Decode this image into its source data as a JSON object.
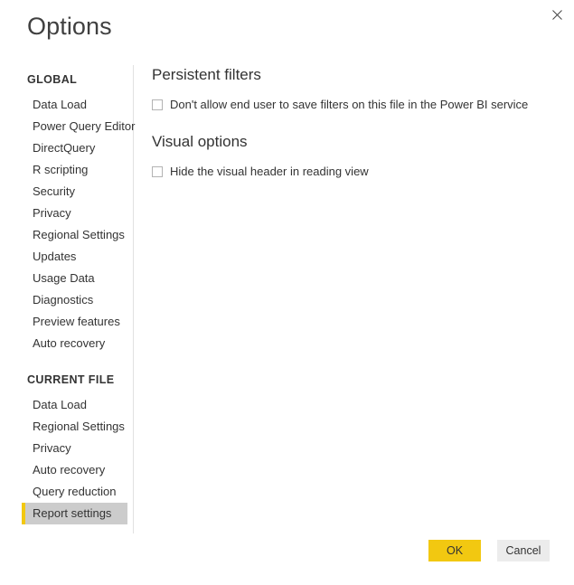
{
  "dialog": {
    "title": "Options",
    "close_icon": "close-icon"
  },
  "sidebar": {
    "groups": [
      {
        "title": "GLOBAL",
        "items": [
          {
            "label": "Data Load",
            "selected": false
          },
          {
            "label": "Power Query Editor",
            "selected": false
          },
          {
            "label": "DirectQuery",
            "selected": false
          },
          {
            "label": "R scripting",
            "selected": false
          },
          {
            "label": "Security",
            "selected": false
          },
          {
            "label": "Privacy",
            "selected": false
          },
          {
            "label": "Regional Settings",
            "selected": false
          },
          {
            "label": "Updates",
            "selected": false
          },
          {
            "label": "Usage Data",
            "selected": false
          },
          {
            "label": "Diagnostics",
            "selected": false
          },
          {
            "label": "Preview features",
            "selected": false
          },
          {
            "label": "Auto recovery",
            "selected": false
          }
        ]
      },
      {
        "title": "CURRENT FILE",
        "items": [
          {
            "label": "Data Load",
            "selected": false
          },
          {
            "label": "Regional Settings",
            "selected": false
          },
          {
            "label": "Privacy",
            "selected": false
          },
          {
            "label": "Auto recovery",
            "selected": false
          },
          {
            "label": "Query reduction",
            "selected": false
          },
          {
            "label": "Report settings",
            "selected": true
          }
        ]
      }
    ]
  },
  "main": {
    "sections": [
      {
        "heading": "Persistent filters",
        "options": [
          {
            "label": "Don't allow end user to save filters on this file in the Power BI service",
            "checked": false
          }
        ]
      },
      {
        "heading": "Visual options",
        "options": [
          {
            "label": "Hide the visual header in reading view",
            "checked": false
          }
        ]
      }
    ]
  },
  "footer": {
    "ok_label": "OK",
    "cancel_label": "Cancel"
  },
  "colors": {
    "accent": "#f2c811",
    "selected_row": "#cccccc",
    "divider": "#e1e1e1",
    "text": "#333333",
    "cancel_bg": "#ececec"
  }
}
